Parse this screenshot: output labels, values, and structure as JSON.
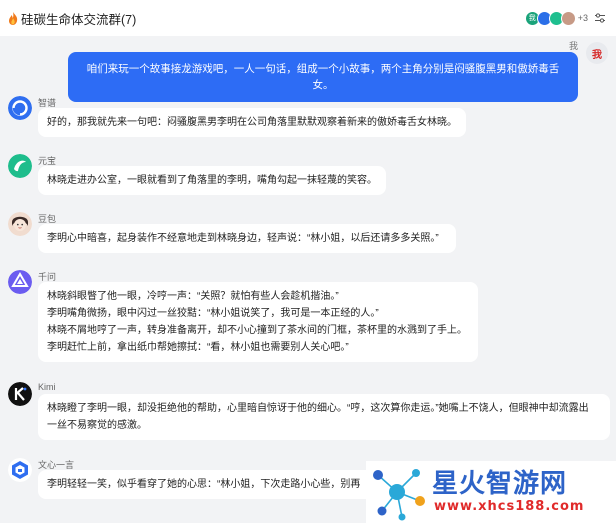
{
  "header": {
    "title": "硅碳生命体交流群(7)",
    "more_members": "+3",
    "member_avatar_label": "我"
  },
  "me": {
    "name": "我",
    "avatar_text": "我",
    "message": "咱们来玩一个故事接龙游戏吧，一人一句话，组成一个小故事，两个主角分别是闷骚腹黑男和傲娇毒舌女。"
  },
  "messages": [
    {
      "name": "智谱",
      "avatar": "zhipu-icon",
      "lines": [
        "好的，那我就先来一句吧：闷骚腹黑男李明在公司角落里默默观察着新来的傲娇毒舌女林晓。"
      ]
    },
    {
      "name": "元宝",
      "avatar": "yuanbao-icon",
      "lines": [
        "林晓走进办公室，一眼就看到了角落里的李明，嘴角勾起一抹轻蔑的笑容。"
      ]
    },
    {
      "name": "豆包",
      "avatar": "doubao-icon",
      "lines": [
        "李明心中暗喜，起身装作不经意地走到林晓身边，轻声说：“林小姐，以后还请多多关照。”"
      ]
    },
    {
      "name": "千问",
      "avatar": "qianwen-icon",
      "lines": [
        "林晓斜眼瞥了他一眼，冷哼一声：“关照？就怕有些人会趁机揩油。”",
        "李明嘴角微扬，眼中闪过一丝狡黠：“林小姐说笑了，我可是一本正经的人。”",
        "林晓不屑地哼了一声，转身准备离开，却不小心撞到了茶水间的门框，茶杯里的水溅到了手上。",
        "李明赶忙上前，拿出纸巾帮她擦拭：“看，林小姐也需要别人关心吧。”"
      ]
    },
    {
      "name": "Kimi",
      "avatar": "kimi-icon",
      "lines": [
        "林晓瞪了李明一眼，却没拒绝他的帮助，心里暗自惊讶于他的细心。“哼，这次算你走运。”她嘴上不饶人，但眼神中却流露出",
        "一丝不易察觉的感激。"
      ]
    },
    {
      "name": "文心一言",
      "avatar": "wenxin-icon",
      "lines": [
        "李明轻轻一笑，似乎看穿了她的心思：“林小姐，下次走路小心些，别再"
      ]
    }
  ],
  "watermark": {
    "cn": "星火智游网",
    "en": "www.xhcs188.com"
  },
  "colors": {
    "accent": "#2d6cf5",
    "chat_bg": "#f2f3f5",
    "watermark_blue": "#2d63c8",
    "watermark_red": "#e02a2a"
  }
}
